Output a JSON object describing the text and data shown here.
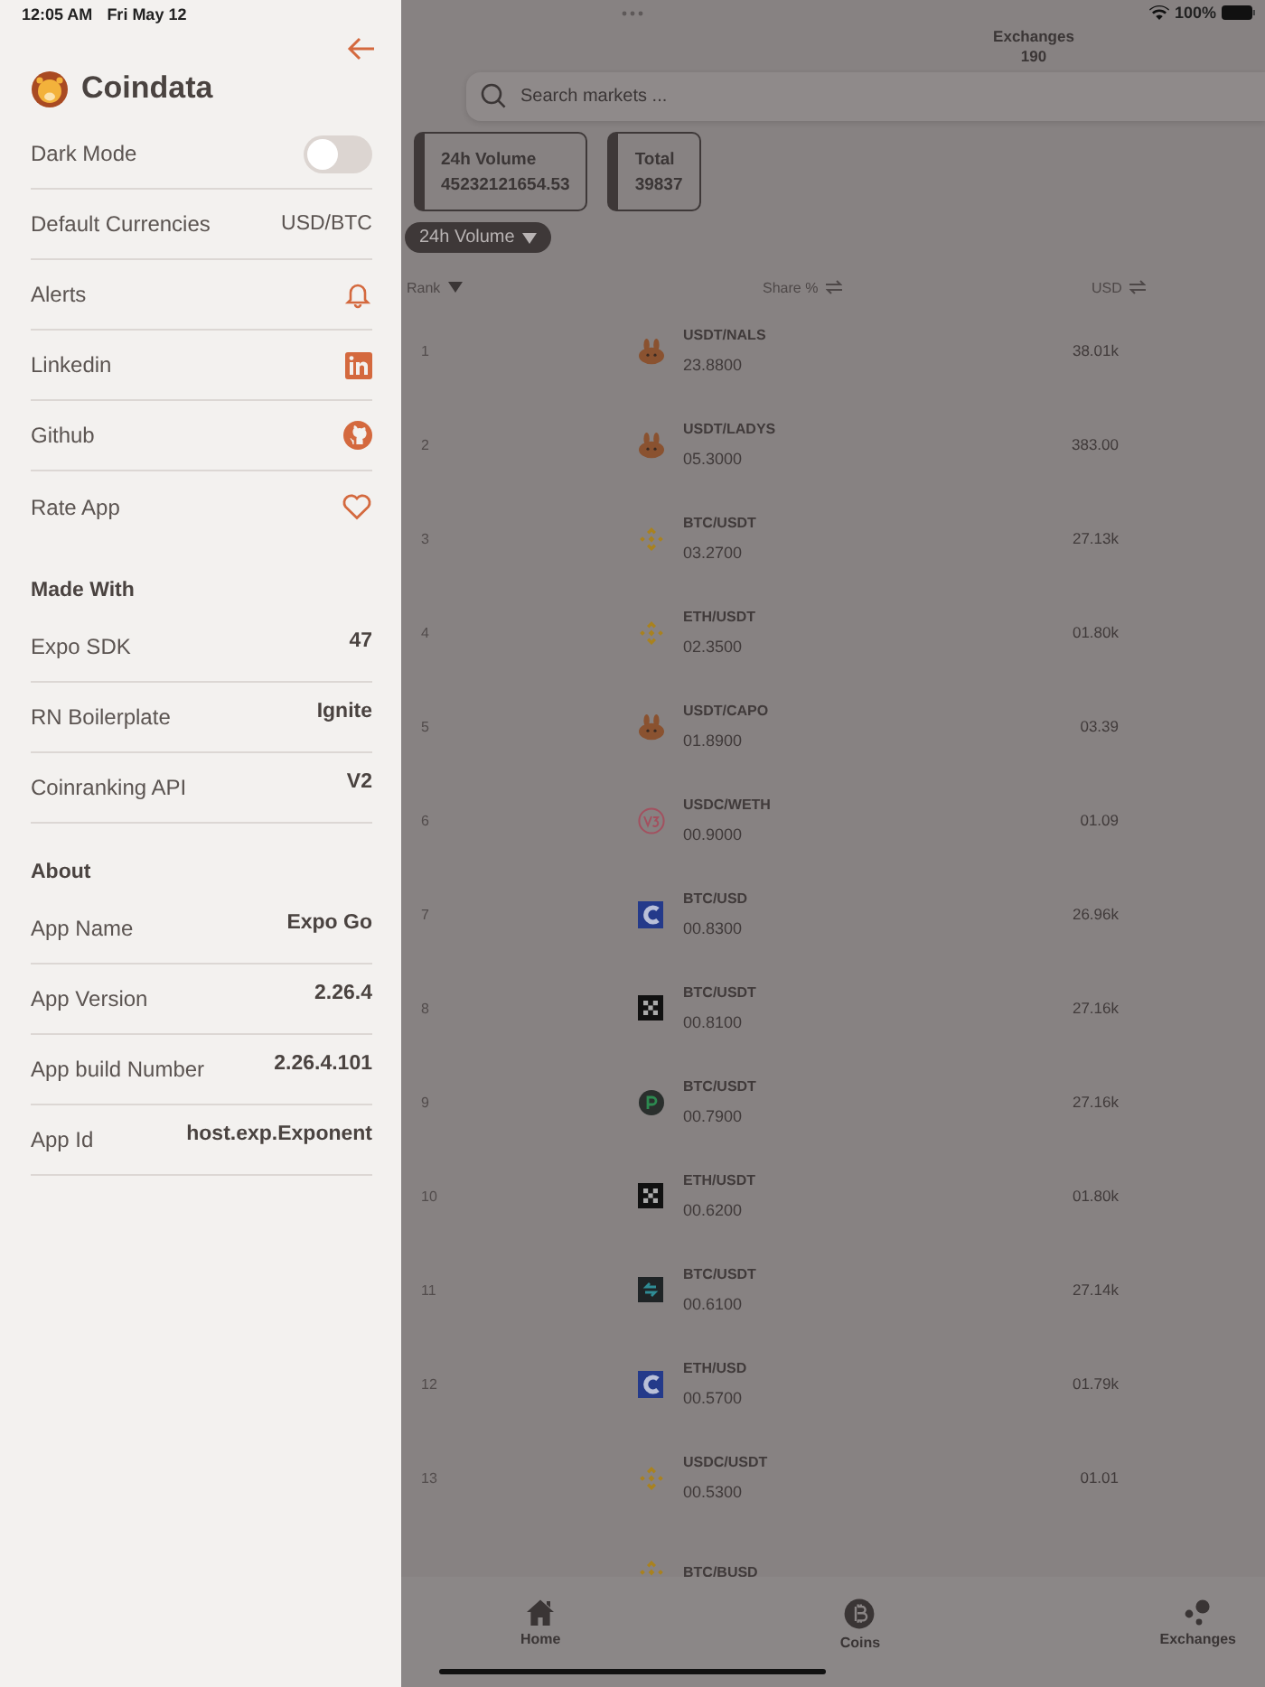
{
  "status_bar": {
    "time": "12:05 AM",
    "date": "Fri May 12",
    "battery": "100%"
  },
  "drawer": {
    "title": "Coindata",
    "settings": [
      {
        "label": "Dark Mode",
        "kind": "toggle",
        "on": false
      },
      {
        "label": "Default Currencies",
        "kind": "value",
        "value": "USD/BTC"
      },
      {
        "label": "Alerts",
        "kind": "bell"
      },
      {
        "label": "Linkedin",
        "kind": "linkedin"
      },
      {
        "label": "Github",
        "kind": "github"
      },
      {
        "label": "Rate App",
        "kind": "heart"
      }
    ],
    "sections": [
      {
        "heading": "Made With",
        "items": [
          {
            "label": "Expo SDK",
            "value": "47"
          },
          {
            "label": "RN Boilerplate",
            "value": "Ignite"
          },
          {
            "label": "Coinranking API",
            "value": "V2"
          }
        ]
      },
      {
        "heading": "About",
        "items": [
          {
            "label": "App Name",
            "value": "Expo Go"
          },
          {
            "label": "App Version",
            "value": "2.26.4"
          },
          {
            "label": "App build Number",
            "value": "2.26.4.101"
          },
          {
            "label": "App Id",
            "value": "host.exp.Exponent"
          }
        ]
      }
    ]
  },
  "markets": {
    "header": {
      "title": "Exchanges",
      "count": "190"
    },
    "search": {
      "placeholder": "Search markets ..."
    },
    "stats": [
      {
        "label": "24h Volume",
        "value": "45232121654.53"
      },
      {
        "label": "Total",
        "value": "39837"
      }
    ],
    "sort_dropdown": "24h Volume",
    "columns": [
      {
        "label": "Rank",
        "kind": "sort"
      },
      {
        "label": "Share %",
        "kind": "swap"
      },
      {
        "label": "USD",
        "kind": "swap"
      }
    ],
    "rows": [
      {
        "rank": "1",
        "kind": "rabbit",
        "pair": "USDT/NALS",
        "share": "23.8800",
        "usd": "38.01k"
      },
      {
        "rank": "2",
        "kind": "rabbit",
        "pair": "USDT/LADYS",
        "share": "05.3000",
        "usd": "383.00"
      },
      {
        "rank": "3",
        "kind": "diamond",
        "pair": "BTC/USDT",
        "share": "03.2700",
        "usd": "27.13k"
      },
      {
        "rank": "4",
        "kind": "diamond",
        "pair": "ETH/USDT",
        "share": "02.3500",
        "usd": "01.80k"
      },
      {
        "rank": "5",
        "kind": "rabbit",
        "pair": "USDT/CAPO",
        "share": "01.8900",
        "usd": "03.39"
      },
      {
        "rank": "6",
        "kind": "ring",
        "pair": "USDC/WETH",
        "share": "00.9000",
        "usd": "01.09"
      },
      {
        "rank": "7",
        "kind": "cblock",
        "pair": "BTC/USD",
        "share": "00.8300",
        "usd": "26.96k"
      },
      {
        "rank": "8",
        "kind": "checker",
        "pair": "BTC/USDT",
        "share": "00.8100",
        "usd": "27.16k"
      },
      {
        "rank": "9",
        "kind": "pcircle",
        "pair": "BTC/USDT",
        "share": "00.7900",
        "usd": "27.16k"
      },
      {
        "rank": "10",
        "kind": "checker",
        "pair": "ETH/USDT",
        "share": "00.6200",
        "usd": "01.80k"
      },
      {
        "rank": "11",
        "kind": "arrows",
        "pair": "BTC/USDT",
        "share": "00.6100",
        "usd": "27.14k"
      },
      {
        "rank": "12",
        "kind": "cblock",
        "pair": "ETH/USD",
        "share": "00.5700",
        "usd": "01.79k"
      },
      {
        "rank": "13",
        "kind": "diamond",
        "pair": "USDC/USDT",
        "share": "00.5300",
        "usd": "01.01"
      },
      {
        "kind": "diamond",
        "pair": "BTC/BUSD"
      }
    ]
  },
  "tab_bar": [
    {
      "label": "Home",
      "kind": "home"
    },
    {
      "label": "Coins",
      "kind": "coin"
    },
    {
      "label": "Exchanges",
      "kind": "dots"
    }
  ]
}
